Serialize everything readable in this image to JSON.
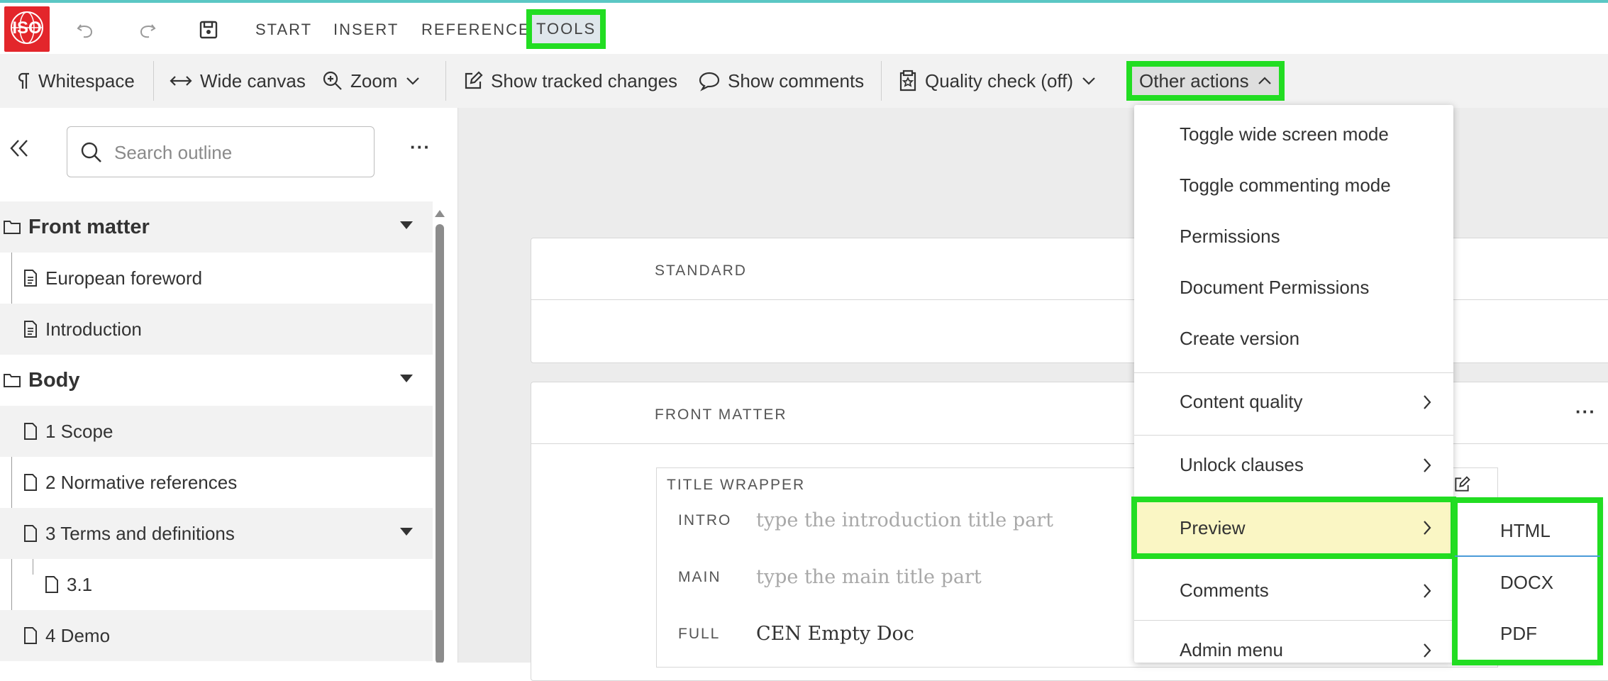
{
  "app": {
    "logo_text": "ISO"
  },
  "menubar": {
    "items": [
      "START",
      "INSERT",
      "REFERENCE",
      "TOOLS"
    ],
    "active": "TOOLS"
  },
  "toolbar": {
    "whitespace": "Whitespace",
    "wide_canvas": "Wide canvas",
    "zoom": "Zoom",
    "show_tracked_changes": "Show tracked changes",
    "show_comments": "Show comments",
    "quality_check": "Quality check (off)",
    "other_actions": "Other actions"
  },
  "sidebar": {
    "search_placeholder": "Search outline",
    "more": "···",
    "tree": {
      "front_matter": "Front matter",
      "european_foreword": "European foreword",
      "introduction": "Introduction",
      "body": "Body",
      "scope": "1 Scope",
      "normative": "2 Normative references",
      "terms": "3 Terms and definitions",
      "terms_sub": "3.1",
      "demo": "4 Demo"
    }
  },
  "canvas": {
    "standard_label": "STANDARD",
    "front_matter_label": "FRONT MATTER",
    "more": "···",
    "title_wrapper_label": "TITLE WRAPPER",
    "intro_label": "INTRO",
    "intro_placeholder": "type the introduction title part",
    "main_label": "MAIN",
    "main_placeholder": "type the main title part",
    "full_label": "FULL",
    "full_value": "CEN Empty Doc"
  },
  "dropdown": {
    "toggle_wide": "Toggle wide screen mode",
    "toggle_commenting": "Toggle commenting mode",
    "permissions": "Permissions",
    "document_permissions": "Document Permissions",
    "create_version": "Create version",
    "content_quality": "Content quality",
    "unlock_clauses": "Unlock clauses",
    "preview": "Preview",
    "comments": "Comments",
    "admin_menu": "Admin menu"
  },
  "preview_submenu": {
    "html": "HTML",
    "docx": "DOCX",
    "pdf": "PDF"
  },
  "colors": {
    "highlight": "#22dd22",
    "logo": "#e3262b",
    "preview_bg": "#faf6c4"
  }
}
